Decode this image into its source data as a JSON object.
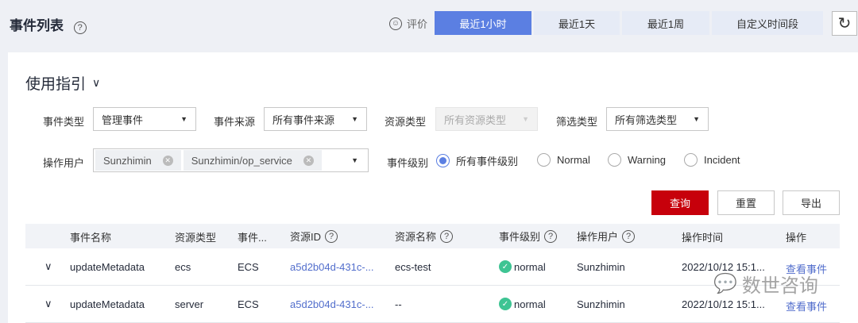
{
  "header": {
    "title": "事件列表",
    "help": "?",
    "rate_label": "评价",
    "tabs": [
      {
        "label": "最近1小时",
        "active": true
      },
      {
        "label": "最近1天"
      },
      {
        "label": "最近1周"
      },
      {
        "label": "自定义时间段"
      }
    ],
    "refresh": "C"
  },
  "guide": {
    "label": "使用指引",
    "chevron": "⌄"
  },
  "filters": {
    "event_type": {
      "label": "事件类型",
      "value": "管理事件"
    },
    "event_source": {
      "label": "事件来源",
      "value": "所有事件来源"
    },
    "resource_type": {
      "label": "资源类型",
      "value": "所有资源类型"
    },
    "filter_type": {
      "label": "筛选类型",
      "value": "所有筛选类型"
    },
    "operator": {
      "label": "操作用户",
      "chips": [
        "Sunzhimin",
        "Sunzhimin/op_service"
      ]
    },
    "level": {
      "label": "事件级别",
      "options": [
        "所有事件级别",
        "Normal",
        "Warning",
        "Incident"
      ],
      "selected": 0
    }
  },
  "actions": {
    "query": "查询",
    "reset": "重置",
    "export": "导出"
  },
  "table": {
    "columns": [
      "事件名称",
      "资源类型",
      "事件...",
      "资源ID",
      "资源名称",
      "事件级别",
      "操作用户",
      "操作时间",
      "操作"
    ],
    "rows": [
      {
        "name": "updateMetadata",
        "rtype": "ecs",
        "source": "ECS",
        "rid": "a5d2b04d-431c-...",
        "rname": "ecs-test",
        "level": "normal",
        "user": "Sunzhimin",
        "time": "2022/10/12 15:1...",
        "action": "查看事件"
      },
      {
        "name": "updateMetadata",
        "rtype": "server",
        "source": "ECS",
        "rid": "a5d2b04d-431c-...",
        "rname": "--",
        "level": "normal",
        "user": "Sunzhimin",
        "time": "2022/10/12 15:1...",
        "action": "查看事件"
      }
    ]
  },
  "watermark": "数世咨询",
  "colors": {
    "accent": "#5b7fe2",
    "primary_button": "#c7000b",
    "link": "#526ecc",
    "normal": "#3ec493"
  }
}
